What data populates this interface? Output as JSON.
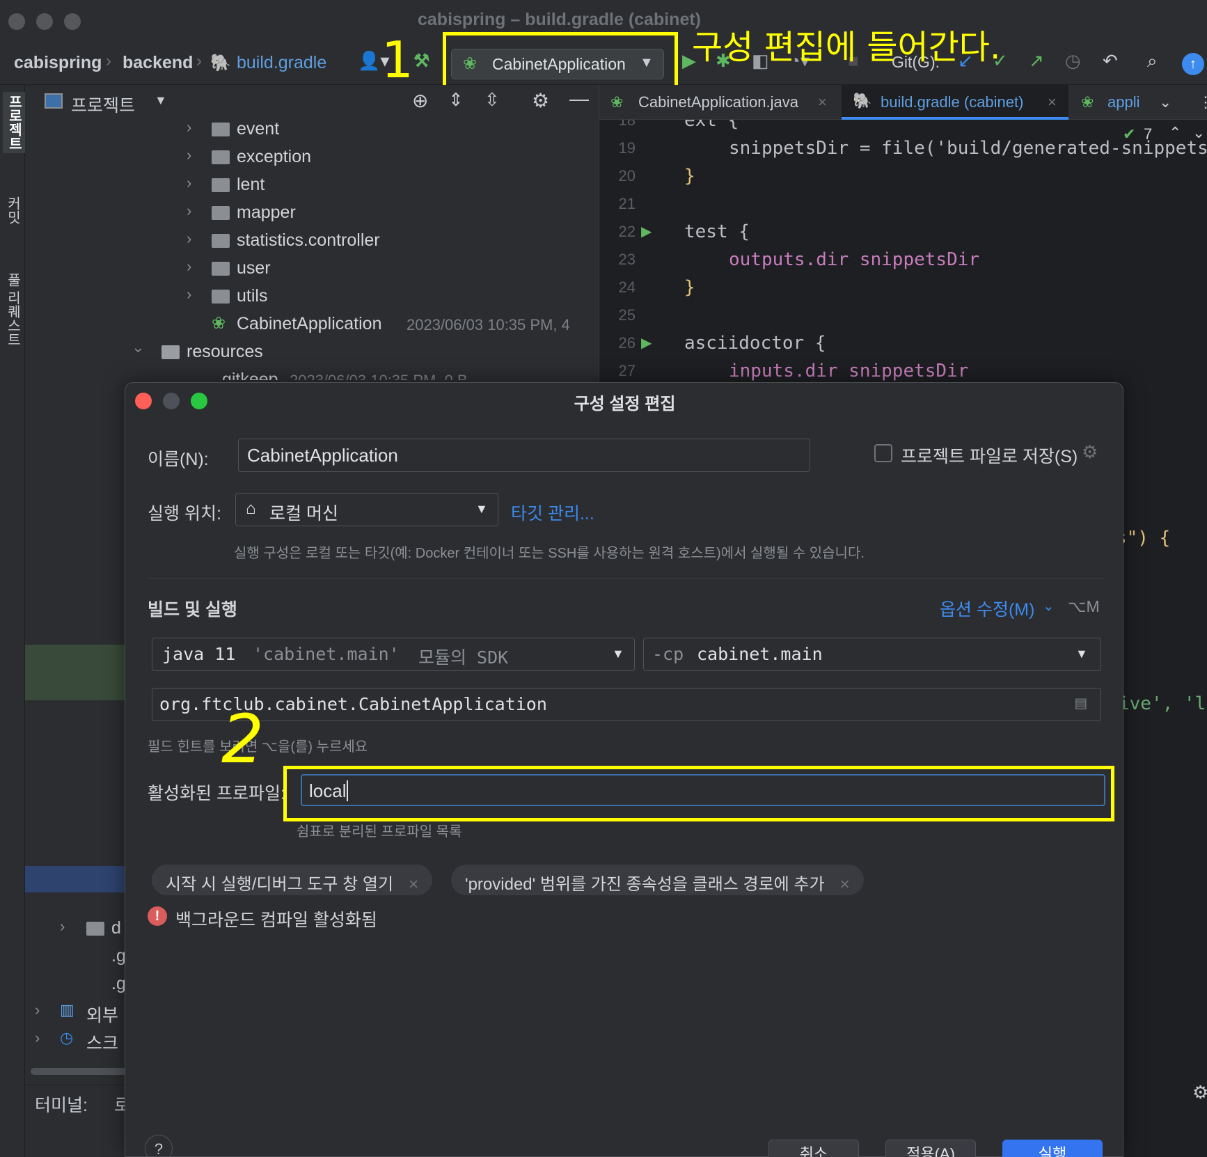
{
  "window": {
    "title": "cabispring – build.gradle (cabinet)"
  },
  "toolbar": {
    "breadcrumbs": [
      "cabispring",
      "backend",
      "build.gradle"
    ],
    "run_config": "CabinetApplication",
    "git_label": "Git(G):"
  },
  "annotations": {
    "step1_number": "1",
    "step1_text": "구성 편집에 들어간다.",
    "step2_number": "2"
  },
  "side_tabs": [
    "프로젝트",
    "커밋",
    "풀 리퀘스트"
  ],
  "project": {
    "header": "프로젝트",
    "tree": [
      {
        "label": "event"
      },
      {
        "label": "exception"
      },
      {
        "label": "lent"
      },
      {
        "label": "mapper"
      },
      {
        "label": "statistics.controller"
      },
      {
        "label": "user"
      },
      {
        "label": "utils"
      },
      {
        "label": "CabinetApplication",
        "meta": "2023/06/03 10:35 PM, 4"
      },
      {
        "label": "resources"
      },
      {
        "label": ".gitkeep",
        "meta": "2023/06/03 10:35 PM, 0 B"
      }
    ],
    "bottom_items": [
      "d",
      ".g",
      ".g",
      "외부",
      "스크리"
    ],
    "terminal_label": "터미널:",
    "terminal_tab": "로"
  },
  "editor": {
    "tabs": [
      "CabinetApplication.java",
      "build.gradle (cabinet)",
      "appli"
    ],
    "inspection_count": "7",
    "lines": [
      {
        "n": "18",
        "text": "ext {"
      },
      {
        "n": "19",
        "text": "snippetsDir = file('build/generated-snippets')"
      },
      {
        "n": "20",
        "text": "}"
      },
      {
        "n": "21",
        "text": ""
      },
      {
        "n": "22",
        "text": "test {"
      },
      {
        "n": "23",
        "text": "outputs.dir snippetsDir"
      },
      {
        "n": "24",
        "text": "}"
      },
      {
        "n": "25",
        "text": ""
      },
      {
        "n": "26",
        "text": "asciidoctor {"
      },
      {
        "n": "27",
        "text": "inputs.dir snippetsDir"
      }
    ],
    "partial_right_1": "s\") {",
    "partial_right_2": "ive', 'l"
  },
  "dialog": {
    "title": "구성 설정 편집",
    "name_label": "이름(N):",
    "name_value": "CabinetApplication",
    "store_checkbox_label": "프로젝트 파일로 저장(S)",
    "run_on_label": "실행 위치:",
    "run_on_value": "로컬 머신",
    "manage_targets": "타깃 관리...",
    "run_on_hint": "실행 구성은 로컬 또는 타깃(예: Docker 컨테이너 또는 SSH를 사용하는 원격 호스트)에서 실행될 수 있습니다.",
    "build_run_header": "빌드 및 실행",
    "modify_options": "옵션 수정(M)",
    "modify_shortcut": "⌥M",
    "sdk_value_java": "java 11",
    "sdk_value_module": "'cabinet.main'",
    "sdk_value_suffix": "모듈의 SDK",
    "cp_prefix": "-cp",
    "cp_value": "cabinet.main",
    "main_class": "org.ftclub.cabinet.CabinetApplication",
    "field_hint": "필드 힌트를 보려면 ⌥을(를) 누르세요",
    "active_profiles_label": "활성화된 프로파일:",
    "active_profiles_value": "local",
    "active_profiles_hint": "쉼표로 분리된 프로파일 목록",
    "chips": [
      "시작 시 실행/디버그 도구 창 열기",
      "'provided' 범위를 가진 종속성을 클래스 경로에 추가"
    ],
    "warning": "백그라운드 컴파일 활성화됨",
    "buttons": {
      "cancel": "취소",
      "apply": "적용(A)",
      "run": "실행"
    },
    "help": "?"
  },
  "colors": {
    "accent": "#3d8bef",
    "annotation": "#ffff00",
    "run_green": "#4caf50"
  }
}
